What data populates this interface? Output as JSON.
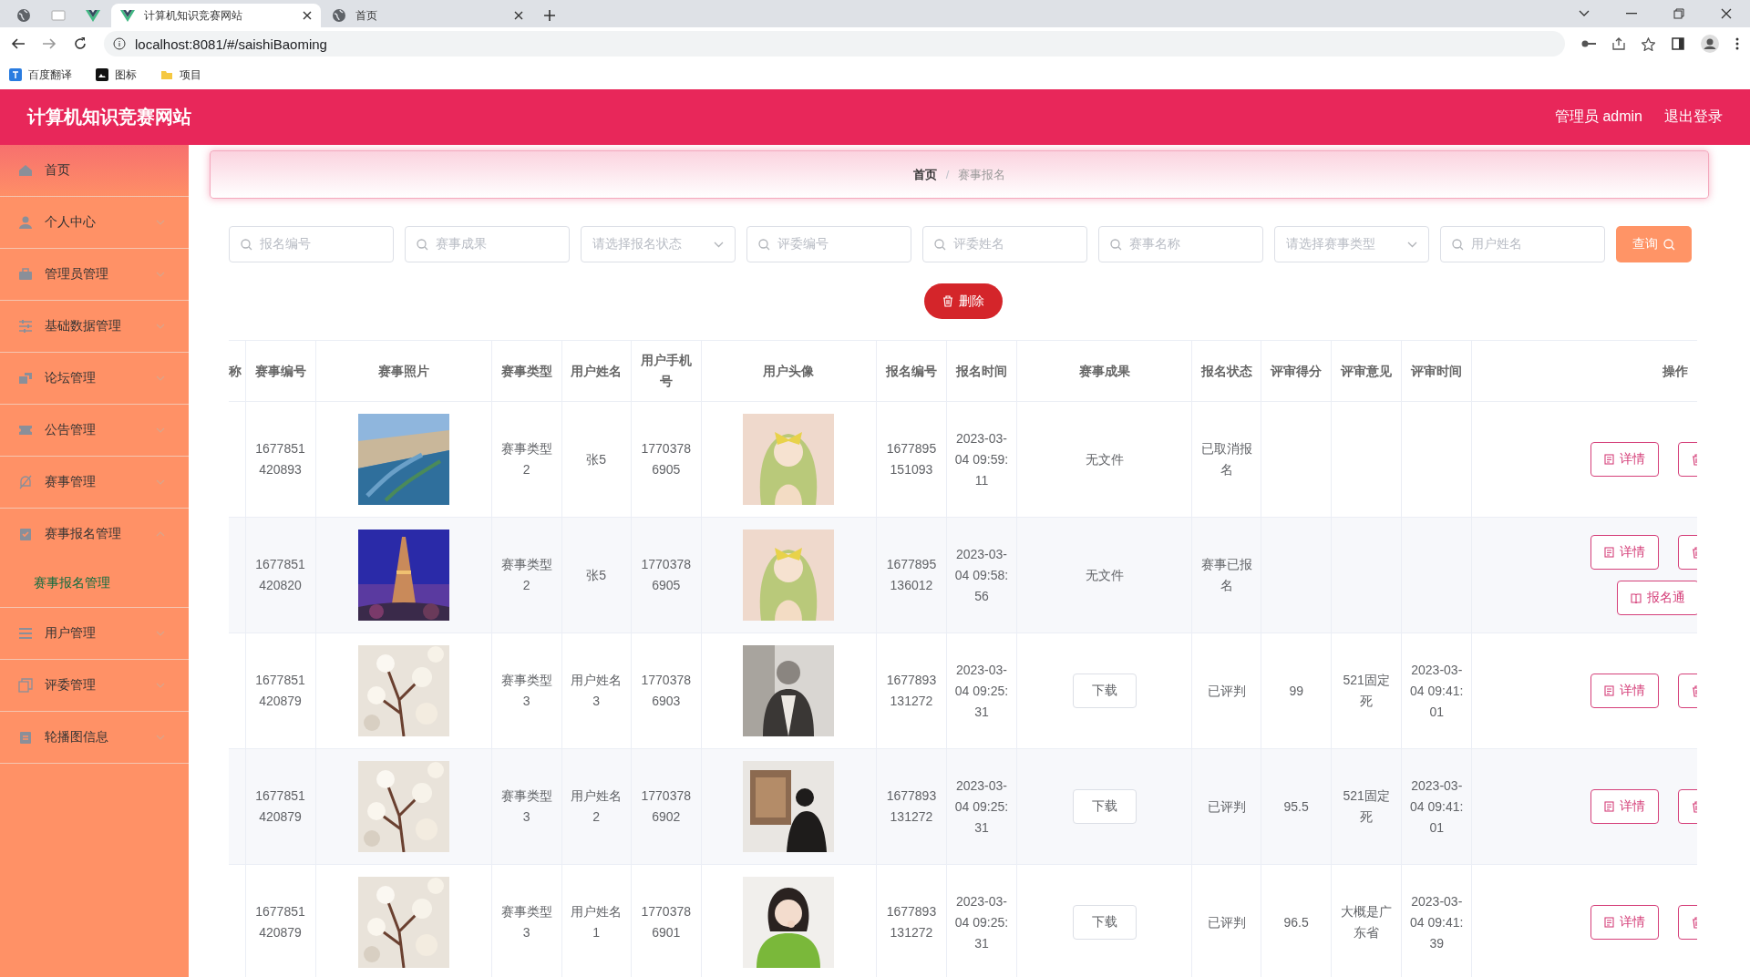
{
  "browser": {
    "tabs": [
      {
        "kind": "pinned",
        "selected": false
      },
      {
        "kind": "pinned",
        "selected": false
      },
      {
        "kind": "pinned",
        "selected": false
      },
      {
        "kind": "page",
        "title": "计算机知识竞赛网站",
        "selected": true
      },
      {
        "kind": "page",
        "title": "首页",
        "selected": false
      }
    ],
    "address": "localhost:8081/#/saishiBaoming",
    "bookmarks": [
      "百度翻译",
      "图标",
      "项目"
    ]
  },
  "header": {
    "title": "计算机知识竞赛网站",
    "user": "管理员 admin",
    "logout": "退出登录"
  },
  "sidebar": {
    "items": [
      {
        "label": "首页",
        "kind": "link"
      },
      {
        "label": "个人中心",
        "kind": "submenu",
        "expanded": false
      },
      {
        "label": "管理员管理",
        "kind": "submenu",
        "expanded": false
      },
      {
        "label": "基础数据管理",
        "kind": "submenu",
        "expanded": false
      },
      {
        "label": "论坛管理",
        "kind": "submenu",
        "expanded": false
      },
      {
        "label": "公告管理",
        "kind": "submenu",
        "expanded": false
      },
      {
        "label": "赛事管理",
        "kind": "submenu",
        "expanded": false
      },
      {
        "label": "赛事报名管理",
        "kind": "submenu",
        "expanded": true,
        "children": [
          {
            "label": "赛事报名管理",
            "selected": true
          }
        ]
      },
      {
        "label": "用户管理",
        "kind": "submenu",
        "expanded": false
      },
      {
        "label": "评委管理",
        "kind": "submenu",
        "expanded": false
      },
      {
        "label": "轮播图信息",
        "kind": "submenu",
        "expanded": false
      }
    ]
  },
  "breadcrumb": {
    "items": [
      "首页",
      "赛事报名"
    ],
    "separator": "/"
  },
  "filters": [
    {
      "kind": "text",
      "placeholder": "报名编号"
    },
    {
      "kind": "text",
      "placeholder": "赛事成果"
    },
    {
      "kind": "select",
      "placeholder": "请选择报名状态"
    },
    {
      "kind": "text",
      "placeholder": "评委编号"
    },
    {
      "kind": "text",
      "placeholder": "评委姓名"
    },
    {
      "kind": "text",
      "placeholder": "赛事名称"
    },
    {
      "kind": "select",
      "placeholder": "请选择赛事类型"
    },
    {
      "kind": "text",
      "placeholder": "用户姓名"
    }
  ],
  "search_button": "查询",
  "delete_button": "删除",
  "table": {
    "columns": [
      "称",
      "赛事编号",
      "赛事照片",
      "赛事类型",
      "用户姓名",
      "用户手机号",
      "用户头像",
      "报名编号",
      "报名时间",
      "赛事成果",
      "报名状态",
      "评审得分",
      "评审意见",
      "评审时间",
      "操作"
    ],
    "rows": [
      {
        "event_no": "1677851420893",
        "photo": {
          "kind": "picture"
        },
        "type": "赛事类型2",
        "user": "张5",
        "phone": "17703786905",
        "avatar": {
          "kind": "picture"
        },
        "reg_no": "1677895151093",
        "time": "2023-03-04 09:59:11",
        "result": {
          "kind": "text",
          "text": "无文件"
        },
        "status": "已取消报名",
        "actions": [
          {
            "kind": "detail",
            "label": "详情"
          },
          {
            "kind": "delete"
          }
        ]
      },
      {
        "event_no": "1677851420820",
        "photo": {
          "kind": "picture"
        },
        "type": "赛事类型2",
        "user": "张5",
        "phone": "17703786905",
        "avatar": {
          "kind": "picture"
        },
        "reg_no": "1677895136012",
        "time": "2023-03-04 09:58:56",
        "result": {
          "kind": "text",
          "text": "无文件"
        },
        "status": "赛事已报名",
        "actions": [
          {
            "kind": "detail",
            "label": "详情"
          },
          {
            "kind": "delete"
          },
          {
            "kind": "approve",
            "label": "报名通"
          }
        ]
      },
      {
        "event_no": "1677851420879",
        "photo": {
          "kind": "picture"
        },
        "type": "赛事类型3",
        "user": "用户姓名3",
        "phone": "17703786903",
        "avatar": {
          "kind": "picture"
        },
        "reg_no": "1677893131272",
        "time": "2023-03-04 09:25:31",
        "result": {
          "kind": "download",
          "text": "下载"
        },
        "status": "已评判",
        "score": "99",
        "opinion": "521固定死",
        "review_time": "2023-03-04 09:41:01",
        "actions": [
          {
            "kind": "detail",
            "label": "详情"
          },
          {
            "kind": "delete"
          }
        ]
      },
      {
        "event_no": "1677851420879",
        "photo": {
          "kind": "picture"
        },
        "type": "赛事类型3",
        "user": "用户姓名2",
        "phone": "17703786902",
        "avatar": {
          "kind": "picture"
        },
        "reg_no": "1677893131272",
        "time": "2023-03-04 09:25:31",
        "result": {
          "kind": "download",
          "text": "下载"
        },
        "status": "已评判",
        "score": "95.5",
        "opinion": "521固定死",
        "review_time": "2023-03-04 09:41:01",
        "actions": [
          {
            "kind": "detail",
            "label": "详情"
          },
          {
            "kind": "delete"
          }
        ]
      },
      {
        "event_no": "1677851420879",
        "photo": {
          "kind": "picture"
        },
        "type": "赛事类型3",
        "user": "用户姓名1",
        "phone": "17703786901",
        "avatar": {
          "kind": "picture"
        },
        "reg_no": "1677893131272",
        "time": "2023-03-04 09:25:31",
        "result": {
          "kind": "download",
          "text": "下载"
        },
        "status": "已评判",
        "score": "96.5",
        "opinion": "大概是广东省",
        "review_time": "2023-03-04 09:41:39",
        "actions": [
          {
            "kind": "detail",
            "label": "详情"
          },
          {
            "kind": "delete"
          }
        ]
      }
    ]
  }
}
